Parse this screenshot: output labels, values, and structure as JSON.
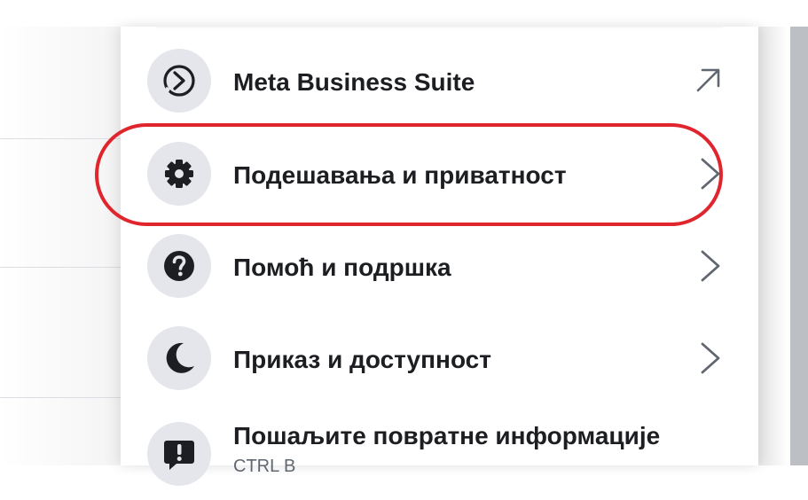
{
  "menu": {
    "items": [
      {
        "label": "Meta Business Suite",
        "icon": "meta-business-suite-icon",
        "trailing": "external-link-arrow"
      },
      {
        "label": "Подешавања и приватност",
        "icon": "gear-icon",
        "trailing": "chevron-right",
        "highlighted": true
      },
      {
        "label": "Помоћ и подршка",
        "icon": "help-question-icon",
        "trailing": "chevron-right"
      },
      {
        "label": "Приказ и доступност",
        "icon": "moon-icon",
        "trailing": "chevron-right"
      },
      {
        "label": "Пошаљите повратне информације",
        "sublabel": "CTRL B",
        "icon": "feedback-icon",
        "trailing": "none"
      }
    ]
  },
  "colors": {
    "highlight_ring": "#e0252d",
    "icon_background": "#e4e6eb",
    "text_primary": "#1c1e21",
    "chevron": "#606770"
  }
}
